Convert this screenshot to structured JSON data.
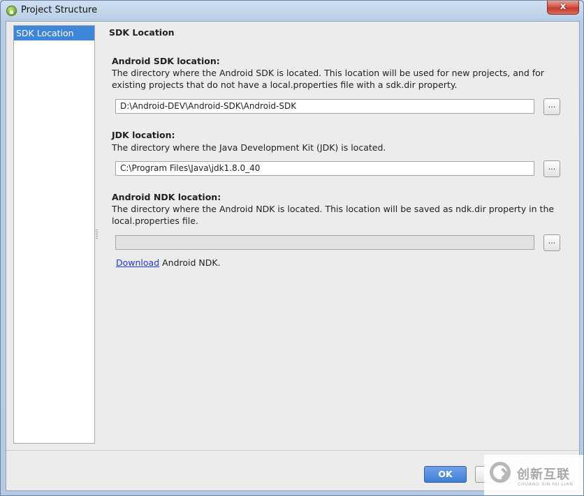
{
  "window": {
    "title": "Project Structure",
    "close_label": "x"
  },
  "sidebar": {
    "items": [
      {
        "label": "SDK Location",
        "selected": true
      }
    ]
  },
  "page": {
    "title": "SDK Location"
  },
  "android_sdk": {
    "title": "Android SDK location:",
    "description": "The directory where the Android SDK is located. This location will be used for new projects, and for existing projects that do not have a local.properties file with a sdk.dir property.",
    "value": "D:\\Android-DEV\\Android-SDK\\Android-SDK",
    "browse_label": "..."
  },
  "jdk": {
    "title": "JDK location:",
    "description": "The directory where the Java Development Kit (JDK) is located.",
    "value": "C:\\Program Files\\Java\\jdk1.8.0_40",
    "browse_label": "..."
  },
  "android_ndk": {
    "title": "Android NDK location:",
    "description": "The directory where the Android NDK is located. This location will be saved as ndk.dir property in the local.properties file.",
    "value": "",
    "browse_label": "...",
    "download_link": "Download",
    "download_suffix": " Android NDK."
  },
  "footer": {
    "ok_label": "OK",
    "cancel_label": ""
  },
  "watermark": {
    "text": "创新互联",
    "subtext": "CHUANG XIN HU LIAN"
  },
  "colors": {
    "selection": "#3e86d8",
    "ok_button": "#3f7dd4",
    "link": "#2238d8"
  }
}
